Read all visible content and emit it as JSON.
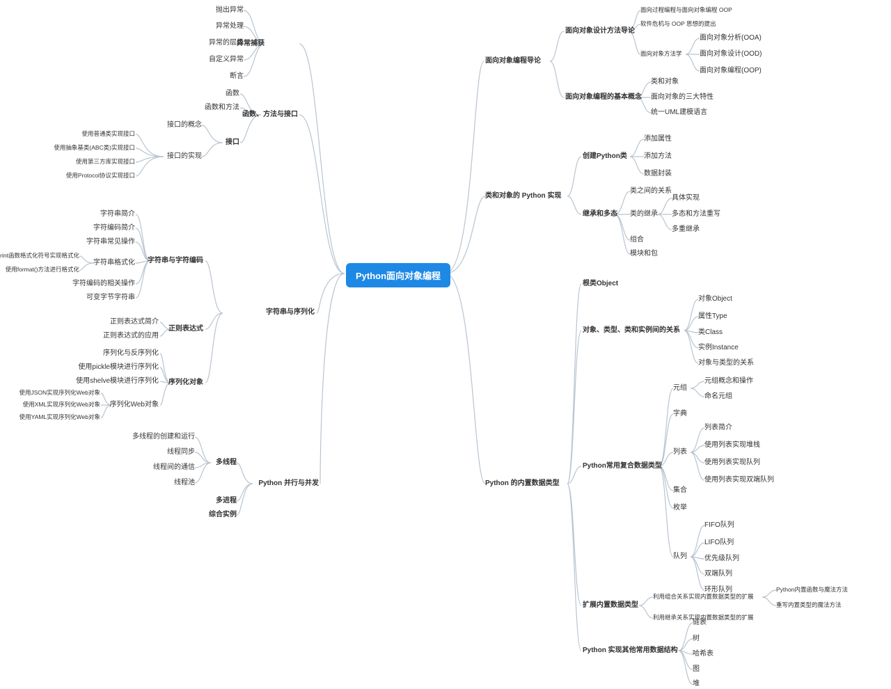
{
  "root": "Python面向对象编程",
  "left": {
    "exception": {
      "title": "异常捕获",
      "items": [
        "抛出异常",
        "异常处理",
        "异常的层级",
        "自定义异常",
        "断言"
      ]
    },
    "func": {
      "title": "函数、方法与接口",
      "items": [
        "函数",
        "函数和方法"
      ],
      "iface": {
        "label": "接口",
        "concept": "接口的概念",
        "impl": {
          "label": "接口的实现",
          "items": [
            "使用普通类实现接口",
            "使用抽象基类(ABC类)实现接口",
            "使用第三方库实现接口",
            "使用Protocol协议实现接口"
          ]
        }
      }
    },
    "string": {
      "title": "字符串与序列化",
      "charenc": {
        "label": "字符串与字符编码",
        "items": [
          "字符串简介",
          "字符编码简介",
          "字符串常见操作"
        ],
        "fmt": {
          "label": "字符串格式化",
          "items": [
            "使用Print函数格式化符号实现格式化",
            "使用format()方法进行格式化"
          ]
        },
        "extra": [
          "字符编码的相关操作",
          "可变字节字符串"
        ]
      },
      "regex": {
        "label": "正则表达式",
        "items": [
          "正则表达式简介",
          "正则表达式的应用"
        ]
      },
      "serial": {
        "label": "序列化对象",
        "items": [
          "序列化与反序列化",
          "使用pickle模块进行序列化",
          "使用shelve模块进行序列化"
        ],
        "web": {
          "label": "序列化Web对象",
          "items": [
            "使用JSON实现序列化Web对象",
            "使用XML实现序列化Web对象",
            "使用YAML实现序列化Web对象"
          ]
        }
      }
    },
    "concur": {
      "title": "Python 并行与并发",
      "thread": {
        "label": "多线程",
        "items": [
          "多线程的创建和运行",
          "线程同步",
          "线程间的通信",
          "线程池"
        ]
      },
      "extra": [
        "多进程",
        "综合实例"
      ]
    }
  },
  "right": {
    "intro": {
      "title": "面向对象编程导论",
      "design": {
        "label": "面向对象设计方法导论",
        "items": [
          "面向过程编程与面向对象编程 OOP",
          "软件危机与 OOP 思想的提出"
        ],
        "methods": {
          "label": "面向对象方法学",
          "items": [
            "面向对象分析(OOA)",
            "面向对象设计(OOD)",
            "面向对象编程(OOP)"
          ]
        }
      },
      "basic": {
        "label": "面向对象编程的基本概念",
        "items": [
          "类和对象",
          "面向对象的三大特性",
          "统一UML建模语言"
        ]
      }
    },
    "classImpl": {
      "title": "类和对象的 Python 实现",
      "create": {
        "label": "创建Python类",
        "items": [
          "添加属性",
          "添加方法",
          "数据封装"
        ]
      },
      "inherit": {
        "label": "继承和多态",
        "rel": "类之间的关系",
        "classInherit": {
          "label": "类的继承",
          "items": [
            "具体实现",
            "多态和方法重写",
            "多重继承"
          ]
        },
        "extra": [
          "组合",
          "模块和包"
        ]
      }
    },
    "builtin": {
      "title": "Python 的内置数据类型",
      "rootObj": "根类Object",
      "rel": {
        "label": "对象、类型、类和实例间的关系",
        "items": [
          "对象Object",
          "属性Type",
          "类Class",
          "实例Instance",
          "对象与类型的关系"
        ]
      },
      "compound": {
        "label": "Python常用复合数据类型",
        "tuple": {
          "label": "元组",
          "items": [
            "元组概念和操作",
            "命名元组"
          ]
        },
        "dict": "字典",
        "list": {
          "label": "列表",
          "items": [
            "列表简介",
            "使用列表实现堆栈",
            "使用列表实现队列",
            "使用列表实现双端队列"
          ]
        },
        "set": "集合",
        "enum": "枚举",
        "queue": {
          "label": "队列",
          "items": [
            "FIFO队列",
            "LIFO队列",
            "优先级队列",
            "双端队列",
            "环形队列"
          ]
        }
      },
      "extend": {
        "label": "扩展内置数据类型",
        "comp": {
          "label": "利用组合关系实现内置数据类型的扩展",
          "items": [
            "Python内置函数与魔法方法",
            "重写内置类型的魔法方法"
          ]
        },
        "inh": "利用继承关系实现内置数据类型的扩展"
      },
      "other": {
        "label": "Python 实现其他常用数据结构",
        "items": [
          "链表",
          "树",
          "哈希表",
          "图",
          "堆"
        ]
      }
    }
  }
}
